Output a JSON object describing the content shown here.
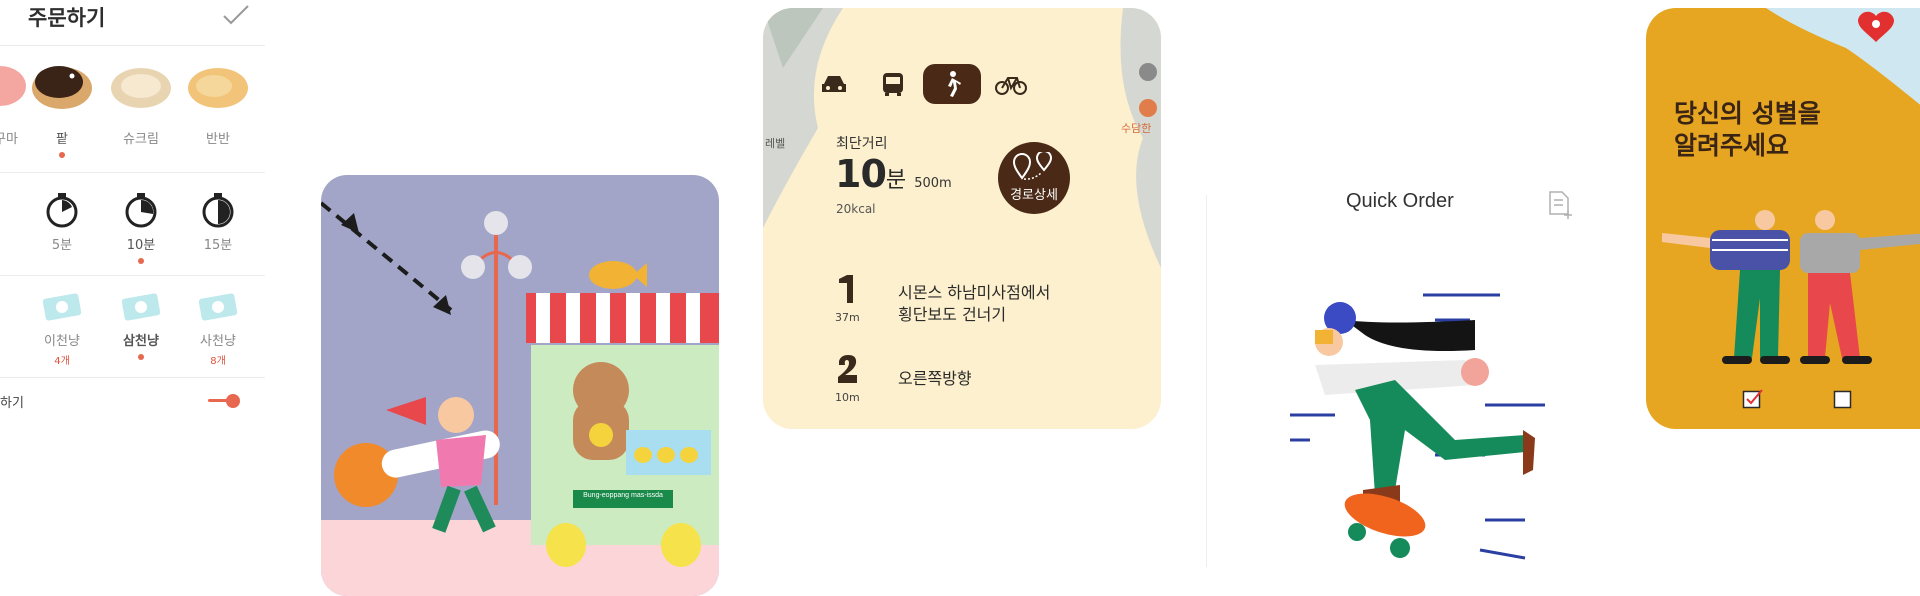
{
  "order": {
    "title": "주문하기",
    "flavors": [
      {
        "label": "고구마",
        "selected": false
      },
      {
        "label": "팥",
        "selected": true
      },
      {
        "label": "슈크림",
        "selected": false
      },
      {
        "label": "반반",
        "selected": false
      }
    ],
    "times": [
      {
        "label": "5분",
        "selected": false
      },
      {
        "label": "10분",
        "selected": true
      },
      {
        "label": "15분",
        "selected": false
      }
    ],
    "prices": [
      {
        "label": "이천냥",
        "count": "4개",
        "selected": false
      },
      {
        "label": "삼천냥",
        "count": "",
        "selected": true
      },
      {
        "label": "사천냥",
        "count": "8개",
        "selected": false
      }
    ],
    "toggle_label": "하기"
  },
  "street": {
    "sign_text": "Bung-eoppang mas-issda"
  },
  "route": {
    "shortest_label": "최단거리",
    "minutes": "10",
    "minutes_unit": "분",
    "distance": "500m",
    "kcal": "20kcal",
    "detail_button": "경로상세",
    "steps": [
      {
        "instruction_line1": "시몬스 하남미사점에서",
        "instruction_line2": "횡단보도 건너기",
        "distance": "37m"
      },
      {
        "instruction_line1": "오른쪽방향",
        "instruction_line2": "",
        "distance": "10m"
      }
    ],
    "map_labels": [
      "레벨",
      "수담한"
    ]
  },
  "quick": {
    "title": "Quick Order"
  },
  "gender": {
    "title_line1": "당신의 성별을",
    "title_line2": "알려주세요",
    "female_checked": true,
    "male_checked": false
  },
  "colors": {
    "accent": "#e8674f",
    "brown": "#4a2a16",
    "map_bg": "#fdf0ce",
    "gender_bg": "#e7a622",
    "street_bg": "#a3a5c8"
  }
}
